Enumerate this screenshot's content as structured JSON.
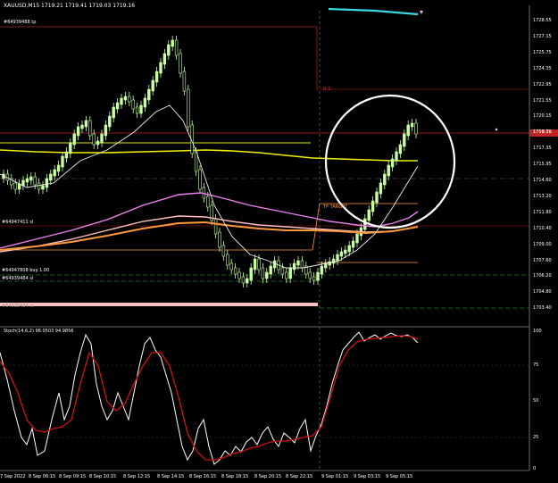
{
  "header": {
    "symbol_text": "XAUUSD,M15",
    "ohlc_text": "XAUUSD,M15  1719.21 1719.41 1719.03 1719.16",
    "order_tp_label": "#64939488 tp"
  },
  "price_axis": {
    "ticks": [
      "1728.55",
      "1727.15",
      "1725.75",
      "1724.35",
      "1722.95",
      "1721.55",
      "1720.15",
      "1718.76",
      "1717.35",
      "1715.95",
      "1714.60",
      "1713.20",
      "1711.80",
      "1710.40",
      "1709.00",
      "1707.60",
      "1706.20",
      "1704.80",
      "1703.40"
    ],
    "current_price_tag": "1719.16"
  },
  "order_labels": {
    "sl1": "#64947411 sl",
    "buy": "#64947808 buy 1.00",
    "sl2": "#64939484 sl",
    "bottom": "#64938484 sl"
  },
  "markers": {
    "r_marker": "R 1",
    "box_text": "TP TARGET"
  },
  "indicator": {
    "label_text": "Stoch(14,6,2) 98.0503 94.9856",
    "levels": [
      "100",
      "75",
      "50",
      "25",
      "0"
    ]
  },
  "time_axis": {
    "labels": [
      "7 Sep 2022",
      "8 Sep 06:15",
      "8 Sep 09:15",
      "8 Sep 10:15",
      "8 Sep 12:15",
      "8 Sep 14:15",
      "8 Sep 16:15",
      "8 Sep 18:15",
      "8 Sep 20:15",
      "8 Sep 22:15",
      "9 Sep 01:15",
      "9 Sep 03:15",
      "9 Sep 05:15"
    ]
  },
  "colors": {
    "background": "#000000",
    "bull_candle": "#c8ffa0",
    "sma_yellow": "#f0f000",
    "ma_violet": "#ee82ee",
    "ma_orange": "#ff9a3c",
    "ma_pink": "#ffc0c0",
    "stoch_main": "#ffffff",
    "stoch_signal": "#d01010",
    "level_red": "#aa2020",
    "level_green": "#3fb03f",
    "level_orange": "#ff9a3c",
    "highlight_circle": "#ffffff",
    "top_line": "#3ad7e0"
  }
}
